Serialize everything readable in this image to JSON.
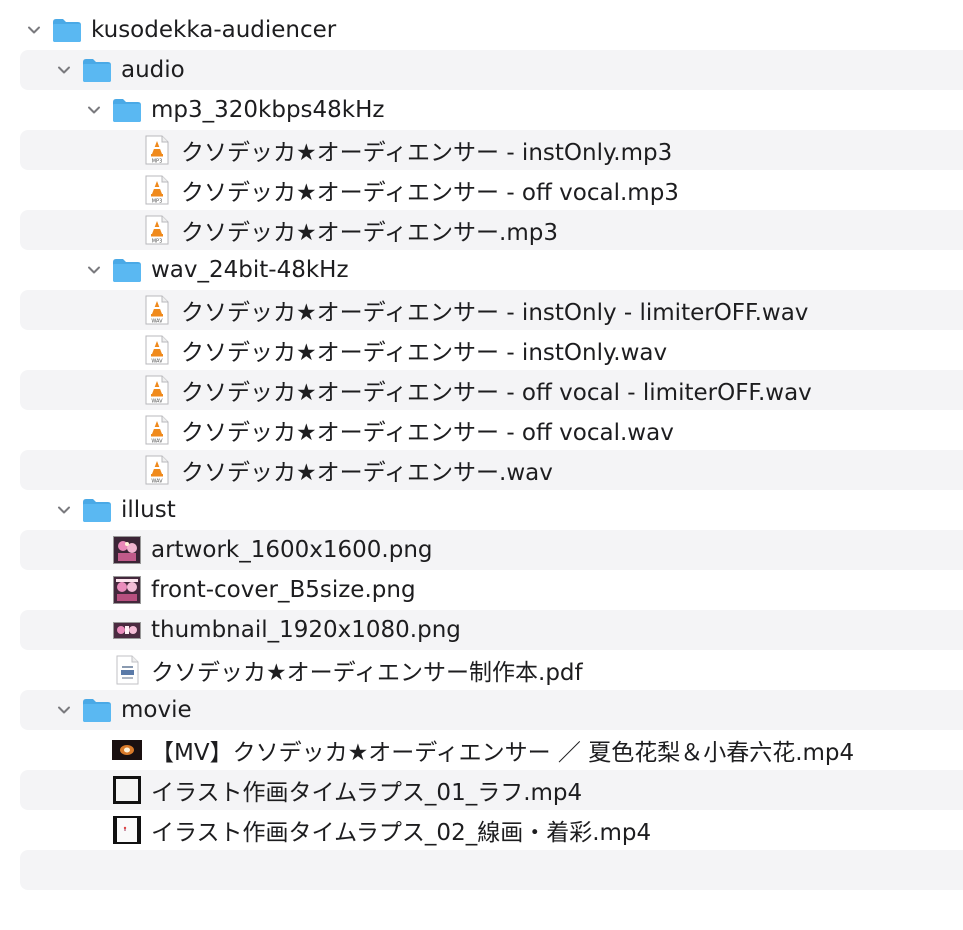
{
  "tree": {
    "root": {
      "label": "kusodekka-audiencer",
      "icon": "folder-icon"
    },
    "audio": {
      "label": "audio",
      "icon": "folder-icon"
    },
    "mp3": {
      "label": "mp3_320kbps48kHz",
      "icon": "folder-icon",
      "files": [
        {
          "label": "クソデッカ★オーディエンサー - instOnly.mp3",
          "icon": "mp3-file-icon",
          "badge": "MP3"
        },
        {
          "label": "クソデッカ★オーディエンサー - off vocal.mp3",
          "icon": "mp3-file-icon",
          "badge": "MP3"
        },
        {
          "label": "クソデッカ★オーディエンサー.mp3",
          "icon": "mp3-file-icon",
          "badge": "MP3"
        }
      ]
    },
    "wav": {
      "label": "wav_24bit-48kHz",
      "icon": "folder-icon",
      "files": [
        {
          "label": "クソデッカ★オーディエンサー - instOnly - limiterOFF.wav",
          "icon": "wav-file-icon",
          "badge": "WAV"
        },
        {
          "label": "クソデッカ★オーディエンサー - instOnly.wav",
          "icon": "wav-file-icon",
          "badge": "WAV"
        },
        {
          "label": "クソデッカ★オーディエンサー - off vocal - limiterOFF.wav",
          "icon": "wav-file-icon",
          "badge": "WAV"
        },
        {
          "label": "クソデッカ★オーディエンサー - off vocal.wav",
          "icon": "wav-file-icon",
          "badge": "WAV"
        },
        {
          "label": "クソデッカ★オーディエンサー.wav",
          "icon": "wav-file-icon",
          "badge": "WAV"
        }
      ]
    },
    "illust": {
      "label": "illust",
      "icon": "folder-icon",
      "files": [
        {
          "label": "artwork_1600x1600.png",
          "icon": "image-thumbnail-icon"
        },
        {
          "label": "front-cover_B5size.png",
          "icon": "image-thumbnail-icon"
        },
        {
          "label": "thumbnail_1920x1080.png",
          "icon": "image-thumbnail-icon"
        },
        {
          "label": "クソデッカ★オーディエンサー制作本.pdf",
          "icon": "pdf-file-icon"
        }
      ]
    },
    "movie": {
      "label": "movie",
      "icon": "folder-icon",
      "files": [
        {
          "label": "【MV】クソデッカ★オーディエンサー ／ 夏色花梨＆小春六花.mp4",
          "icon": "video-thumbnail-icon"
        },
        {
          "label": "イラスト作画タイムラプス_01_ラフ.mp4",
          "icon": "video-thumbnail-icon"
        },
        {
          "label": "イラスト作画タイムラプス_02_線画・着彩.mp4",
          "icon": "video-thumbnail-icon"
        }
      ]
    }
  },
  "colors": {
    "folder_blue": "#5ab8f2",
    "folder_tab": "#4aa9e6",
    "stripe": "#f4f4f6",
    "text": "#1d1d1f",
    "chevron": "#7a7a7e",
    "vlc_orange": "#f08a1c"
  }
}
